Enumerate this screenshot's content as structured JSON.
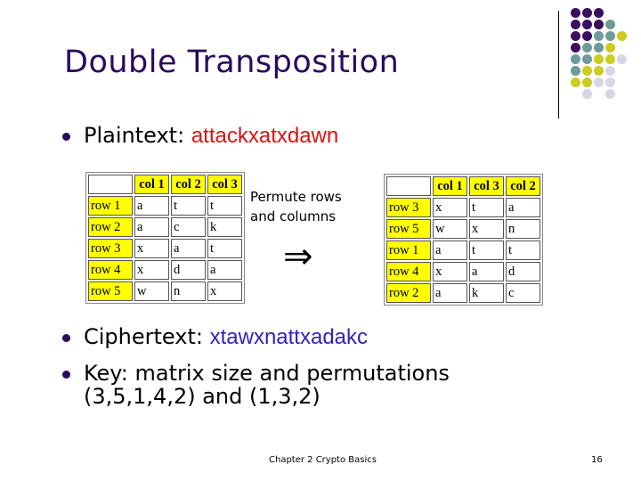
{
  "slide": {
    "title": "Double Transposition",
    "bullets": {
      "plaintext_label": "Plaintext: ",
      "plaintext_value": "attackxatxdawn",
      "ciphertext_label": "Ciphertext: ",
      "ciphertext_value": "xtawxnattxadakc",
      "key_line1": "Key: matrix size and permutations",
      "key_line2": "(3,5,1,4,2) and (1,3,2)"
    },
    "permute_label_line1": "Permute rows",
    "permute_label_line2": "and columns",
    "arrow_symbol": "⇒",
    "footer": {
      "chapter": "Chapter 2 Crypto Basics",
      "page_number": "16"
    },
    "colors": {
      "title": "#2a0a5c",
      "plaintext": "#dd1111",
      "ciphertext": "#3322bb",
      "header_cell": "#ffff00"
    }
  },
  "table_left": {
    "col_headers": [
      "col 1",
      "col 2",
      "col 3"
    ],
    "rows": [
      {
        "label": "row 1",
        "cells": [
          "a",
          "t",
          "t"
        ]
      },
      {
        "label": "row 2",
        "cells": [
          "a",
          "c",
          "k"
        ]
      },
      {
        "label": "row 3",
        "cells": [
          "x",
          "a",
          "t"
        ]
      },
      {
        "label": "row 4",
        "cells": [
          "x",
          "d",
          "a"
        ]
      },
      {
        "label": "row 5",
        "cells": [
          "w",
          "n",
          "x"
        ]
      }
    ]
  },
  "table_right": {
    "col_headers": [
      "col 1",
      "col 3",
      "col 2"
    ],
    "rows": [
      {
        "label": "row 3",
        "cells": [
          "x",
          "t",
          "a"
        ]
      },
      {
        "label": "row 5",
        "cells": [
          "w",
          "x",
          "n"
        ]
      },
      {
        "label": "row 1",
        "cells": [
          "a",
          "t",
          "t"
        ]
      },
      {
        "label": "row 4",
        "cells": [
          "x",
          "a",
          "d"
        ]
      },
      {
        "label": "row 2",
        "cells": [
          "a",
          "k",
          "c"
        ]
      }
    ]
  },
  "decoration": {
    "dot_palette": {
      "P": "#3b0f5e",
      "T": "#6e9a9a",
      "Y": "#cccc22",
      "L": "#d6d6e6"
    },
    "dot_rows": [
      "PPP..",
      "PPPT.",
      "PPTTY",
      "PTTY.",
      "TTYYL",
      "TYYL.",
      "YYLL.",
      ".L.L."
    ]
  }
}
